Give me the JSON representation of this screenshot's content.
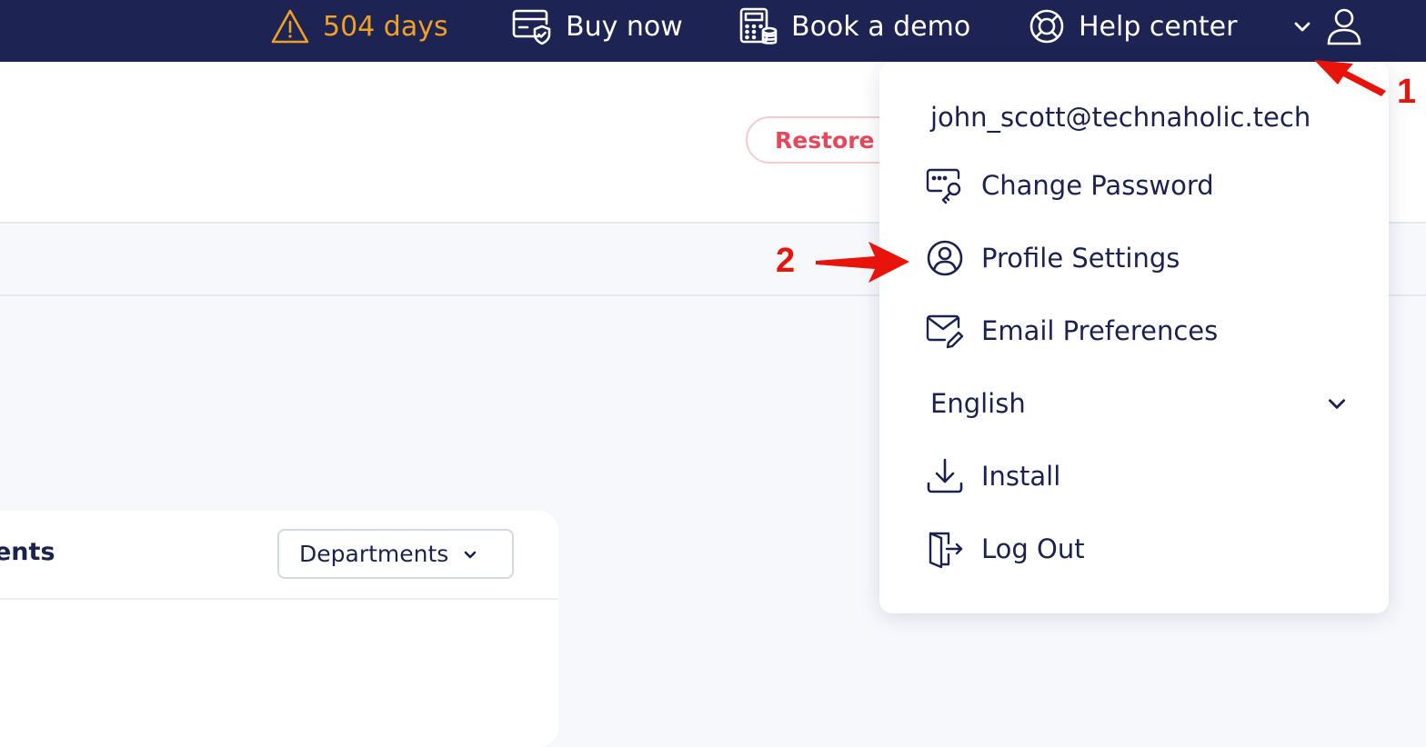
{
  "topbar": {
    "trial_days": "504 days",
    "buy_now": "Buy now",
    "book_demo": "Book a demo",
    "help_center": "Help center",
    "icons": [
      "warning-icon",
      "card-shield-icon",
      "calculator-icon",
      "lifebuoy-icon",
      "chevron-down-icon",
      "user-icon"
    ]
  },
  "header": {
    "restore_button": "Restore t"
  },
  "card": {
    "title": "ents",
    "filter_button": "Departments"
  },
  "user_menu": {
    "email": "john_scott@technaholic.tech",
    "items": [
      {
        "label": "Change Password",
        "icon": "key-icon"
      },
      {
        "label": "Profile Settings",
        "icon": "user-circle-icon"
      },
      {
        "label": "Email Preferences",
        "icon": "mail-edit-icon"
      },
      {
        "label": "Install",
        "icon": "download-icon"
      },
      {
        "label": "Log Out",
        "icon": "logout-icon"
      }
    ],
    "language": "English"
  },
  "annotations": {
    "step1": "1",
    "step2": "2"
  },
  "colors": {
    "topbar_bg": "#1d2352",
    "warning": "#f0a024",
    "restore": "#e5485b",
    "text_dark": "#1b2250",
    "annotation_red": "#e8140c"
  }
}
